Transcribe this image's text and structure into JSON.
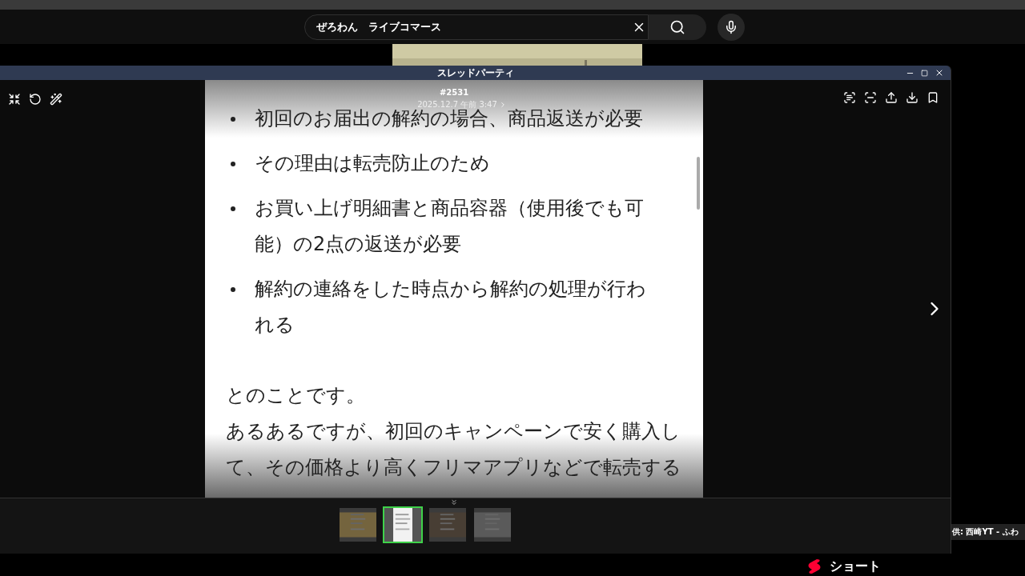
{
  "youtube": {
    "search": {
      "value": "ぜろわん　ライブコマース"
    },
    "credit": "供: 西崎YT - ふわ",
    "shorts": "ショート"
  },
  "viewer": {
    "title": "スレッドパーティ",
    "post": {
      "number": "#2531",
      "date": "2025.12.7 午前 3:47",
      "bullets": [
        "初回のお届出の解約の場合、商品返送が必要",
        "その理由は転売防止のため",
        "お買い上げ明細書と商品容器（使用後でも可能）の2点の返送が必要",
        "解約の連絡をした時点から解約の処理が行われる"
      ],
      "paragraphs": [
        "とのことです。",
        "あるあるですが、初回のキャンペーンで安く購入して、その価格より高くフリマアプリなどで転売する"
      ]
    },
    "thumbnails": [
      {
        "selected": false
      },
      {
        "selected": true
      },
      {
        "selected": false
      },
      {
        "selected": false
      }
    ]
  }
}
